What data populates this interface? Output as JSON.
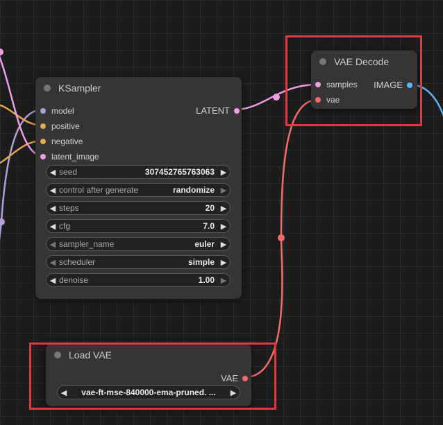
{
  "colors": {
    "model": "#b39ddb",
    "conditioning": "#e3a94b",
    "latent": "#f19ce6",
    "vae": "#f36b6b",
    "image": "#64b5f6",
    "highlight": "#e03a3a"
  },
  "ksampler": {
    "title": "KSampler",
    "inputs": [
      "model",
      "positive",
      "negative",
      "latent_image"
    ],
    "output": "LATENT",
    "widgets": [
      {
        "label": "seed",
        "value": "307452765763063"
      },
      {
        "label": "control after generate",
        "value": "randomize"
      },
      {
        "label": "steps",
        "value": "20"
      },
      {
        "label": "cfg",
        "value": "7.0"
      },
      {
        "label": "sampler_name",
        "value": "euler"
      },
      {
        "label": "scheduler",
        "value": "simple"
      },
      {
        "label": "denoise",
        "value": "1.00"
      }
    ]
  },
  "vae_decode": {
    "title": "VAE Decode",
    "inputs": [
      "samples",
      "vae"
    ],
    "output": "IMAGE"
  },
  "load_vae": {
    "title": "Load VAE",
    "output": "VAE",
    "vae_name": "vae-ft-mse-840000-ema-pruned. ..."
  }
}
